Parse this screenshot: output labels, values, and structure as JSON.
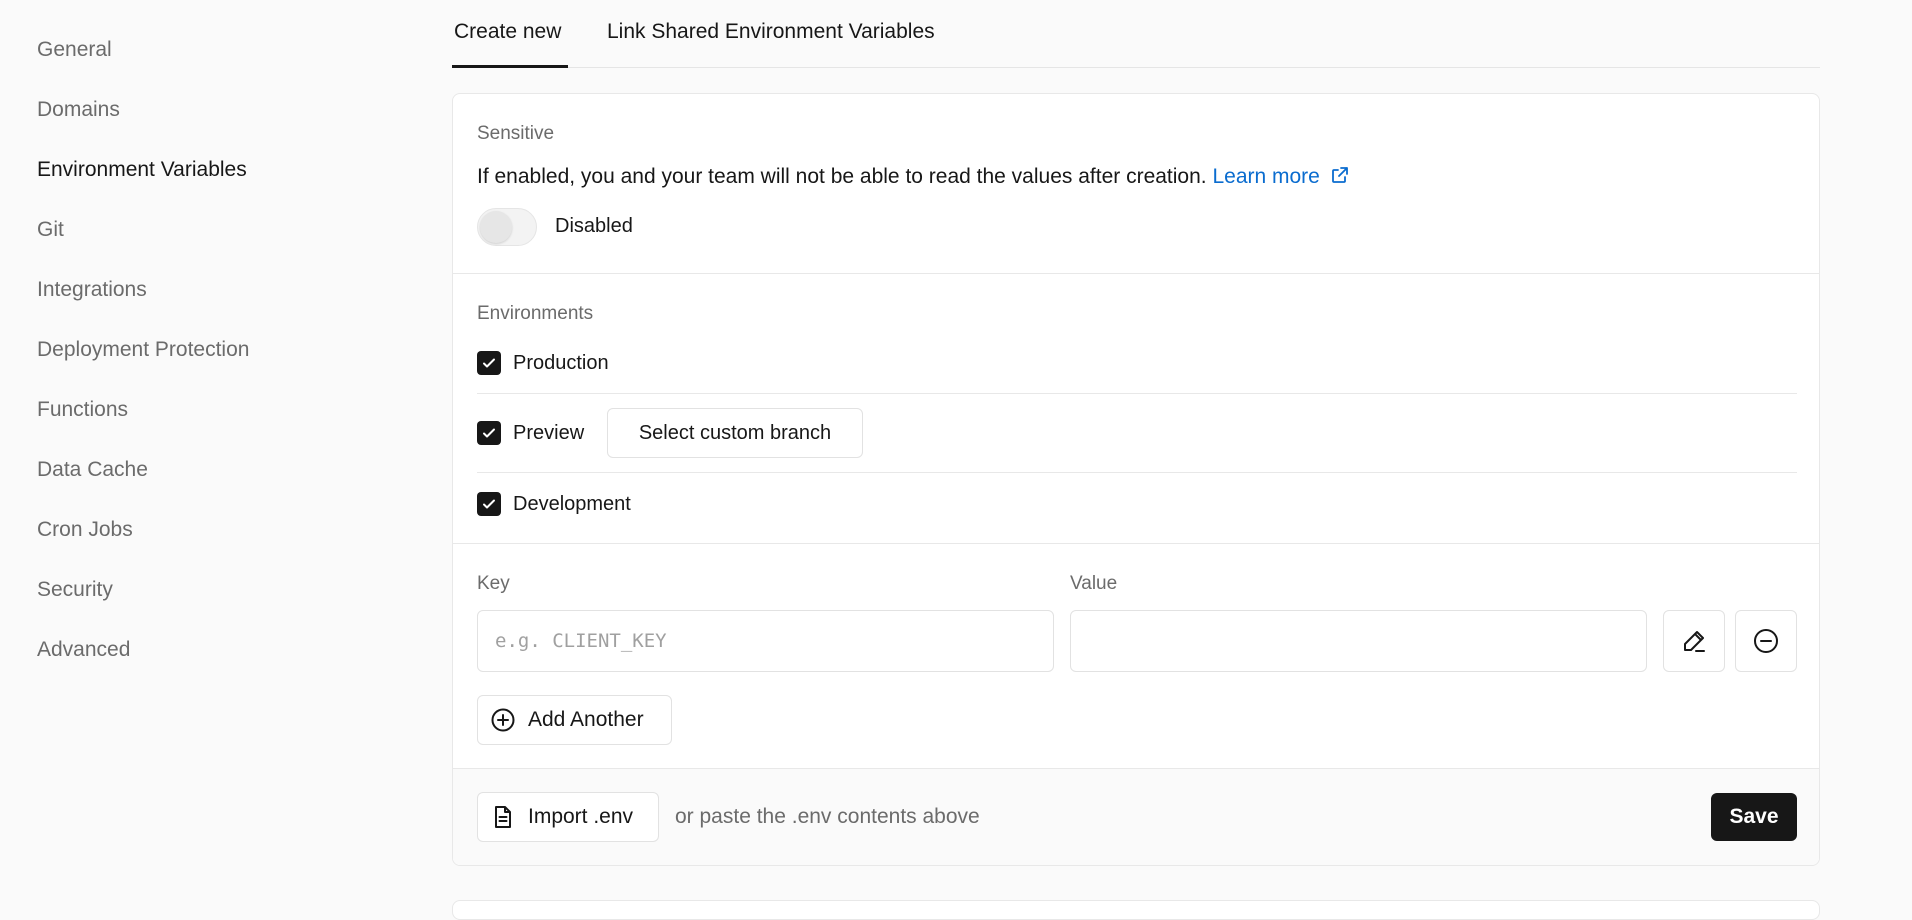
{
  "sidebar": {
    "items": [
      {
        "label": "General"
      },
      {
        "label": "Domains"
      },
      {
        "label": "Environment Variables"
      },
      {
        "label": "Git"
      },
      {
        "label": "Integrations"
      },
      {
        "label": "Deployment Protection"
      },
      {
        "label": "Functions"
      },
      {
        "label": "Data Cache"
      },
      {
        "label": "Cron Jobs"
      },
      {
        "label": "Security"
      },
      {
        "label": "Advanced"
      }
    ],
    "active": "Environment Variables"
  },
  "tabs": [
    {
      "label": "Create new"
    },
    {
      "label": "Link Shared Environment Variables"
    }
  ],
  "active_tab": "Create new",
  "sensitive": {
    "label": "Sensitive",
    "description": "If enabled, you and your team will not be able to read the values after creation.",
    "learn_more": "Learn more",
    "toggle_state": "Disabled",
    "enabled": false
  },
  "environments": {
    "label": "Environments",
    "items": [
      {
        "label": "Production",
        "checked": true
      },
      {
        "label": "Preview",
        "checked": true
      },
      {
        "label": "Development",
        "checked": true
      }
    ],
    "custom_branch_button": "Select custom branch"
  },
  "form": {
    "key_label": "Key",
    "value_label": "Value",
    "key_placeholder": "e.g. CLIENT_KEY",
    "key_value": "",
    "value_value": "",
    "add_another": "Add Another"
  },
  "footer": {
    "import_button": "Import .env",
    "hint": "or paste the .env contents above",
    "save_button": "Save"
  },
  "colors": {
    "accent": "#171717",
    "link": "#0a6ccf",
    "background": "#fafafa"
  },
  "icons": [
    "external-link-icon",
    "check-icon",
    "pencil-icon",
    "minus-circle-icon",
    "plus-circle-icon",
    "file-icon"
  ]
}
